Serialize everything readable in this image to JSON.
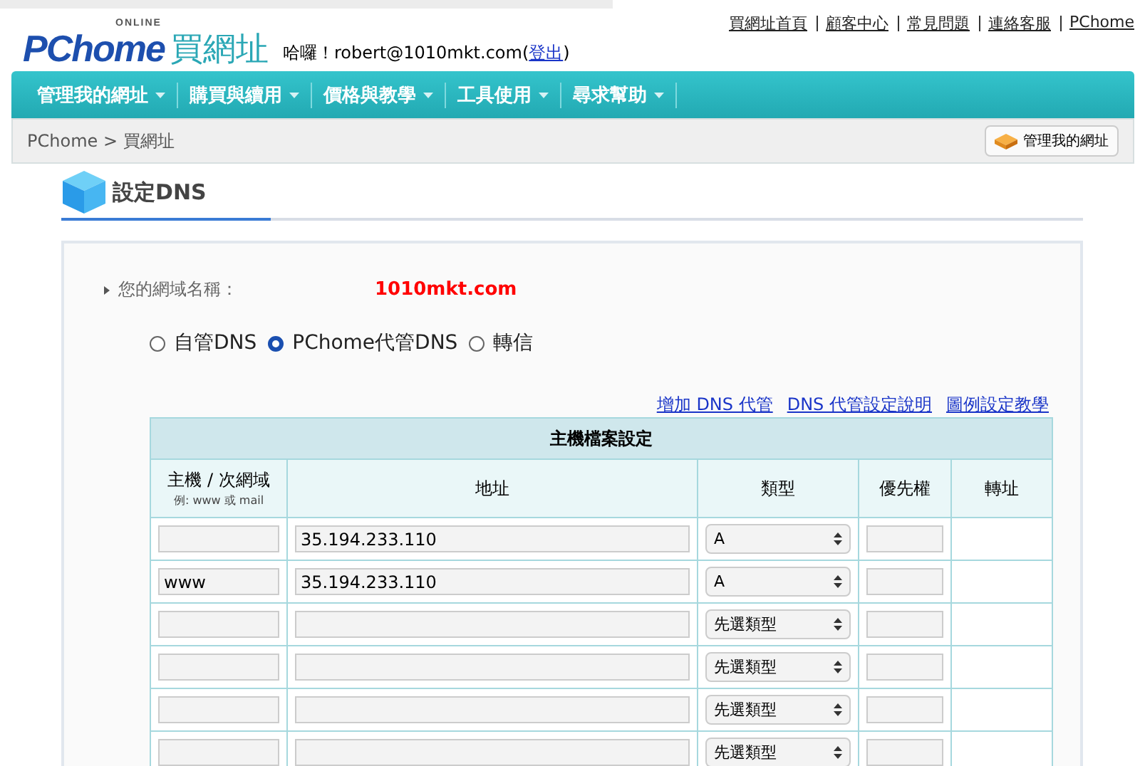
{
  "logo": {
    "brand": "PChome",
    "tag": "ONLINE",
    "product": "買網址"
  },
  "greeting": {
    "text": "哈囉！robert@1010mkt.com(",
    "logout": "登出",
    "close": ")"
  },
  "top_links": [
    "買網址首頁",
    "顧客中心",
    "常見問題",
    "連絡客服",
    "PChome"
  ],
  "nav": [
    "管理我的網址",
    "購買與續用",
    "價格與教學",
    "工具使用",
    "尋求幫助"
  ],
  "breadcrumb": "PChome > 買網址",
  "manage_button": "管理我的網址",
  "section_title": "設定DNS",
  "domain": {
    "label": "您的網域名稱：",
    "value": "1010mkt.com"
  },
  "dns_options": [
    {
      "label": "自管DNS",
      "selected": false
    },
    {
      "label": "PChome代管DNS",
      "selected": true
    },
    {
      "label": "轉信",
      "selected": false
    }
  ],
  "help_links": [
    "增加 DNS 代管",
    "DNS 代管設定說明",
    "圖例設定教學"
  ],
  "table": {
    "title": "主機檔案設定",
    "columns": [
      {
        "label": "主機 / 次網域",
        "hint": "例: www 或 mail"
      },
      {
        "label": "地址"
      },
      {
        "label": "類型"
      },
      {
        "label": "優先權"
      },
      {
        "label": "轉址"
      }
    ],
    "rows": [
      {
        "host": "",
        "address": "35.194.233.110",
        "type": "A"
      },
      {
        "host": "www",
        "address": "35.194.233.110",
        "type": "A"
      },
      {
        "host": "",
        "address": "",
        "type": "先選類型"
      },
      {
        "host": "",
        "address": "",
        "type": "先選類型"
      },
      {
        "host": "",
        "address": "",
        "type": "先選類型"
      },
      {
        "host": "",
        "address": "",
        "type": "先選類型"
      }
    ]
  }
}
